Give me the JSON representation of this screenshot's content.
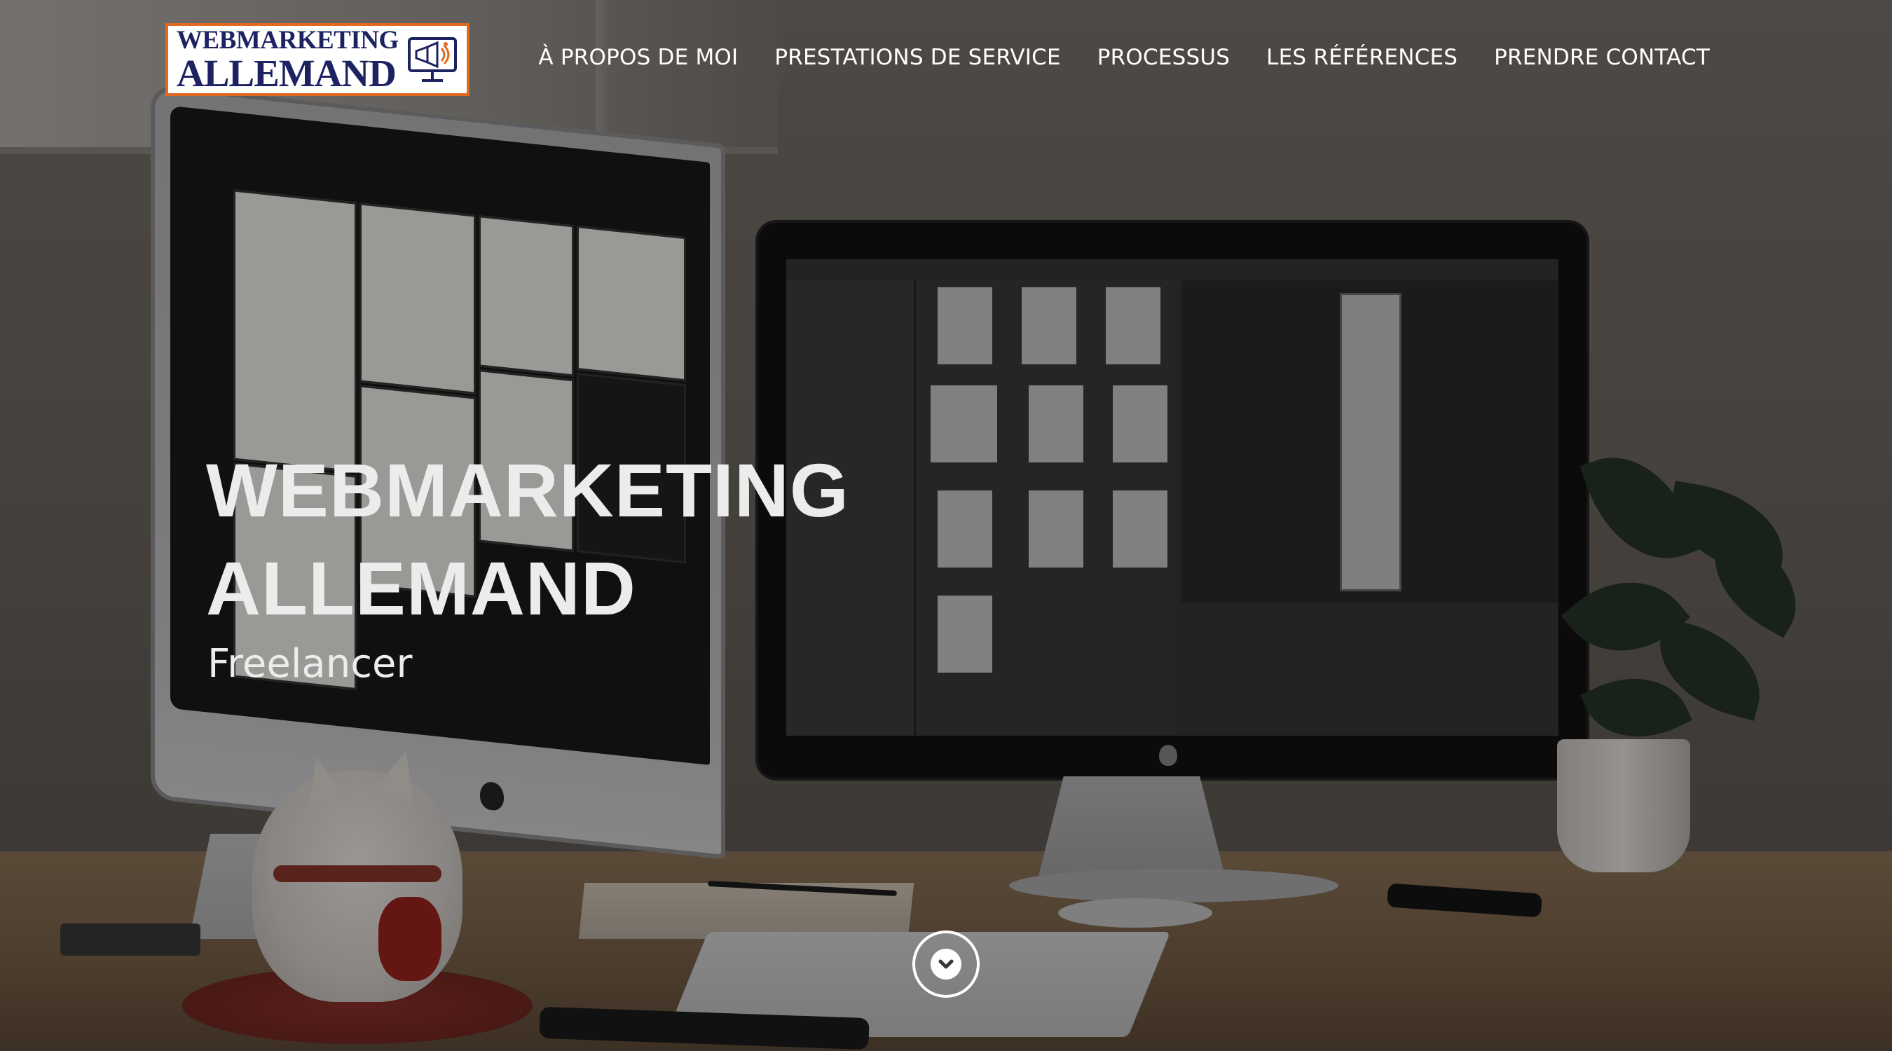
{
  "header": {
    "logo": {
      "line1": "WEBMARKETING",
      "line2": "ALLEMAND",
      "icon": "monitor-megaphone-icon",
      "text_color": "#1d2361",
      "border_color": "#e06a1f"
    },
    "nav": [
      {
        "label": "À PROPOS DE MOI"
      },
      {
        "label": "PRESTATIONS DE SERVICE"
      },
      {
        "label": "PROCESSUS"
      },
      {
        "label": "LES RÉFÉRENCES"
      },
      {
        "label": "PRENDRE CONTACT"
      }
    ]
  },
  "hero": {
    "title_line1": "WEBMARKETING",
    "title_line2": "ALLEMAND",
    "subtitle": "Freelancer",
    "scroll_icon": "chevron-down-icon"
  },
  "colors": {
    "nav_text": "#ffffff",
    "hero_text": "#ececec"
  }
}
